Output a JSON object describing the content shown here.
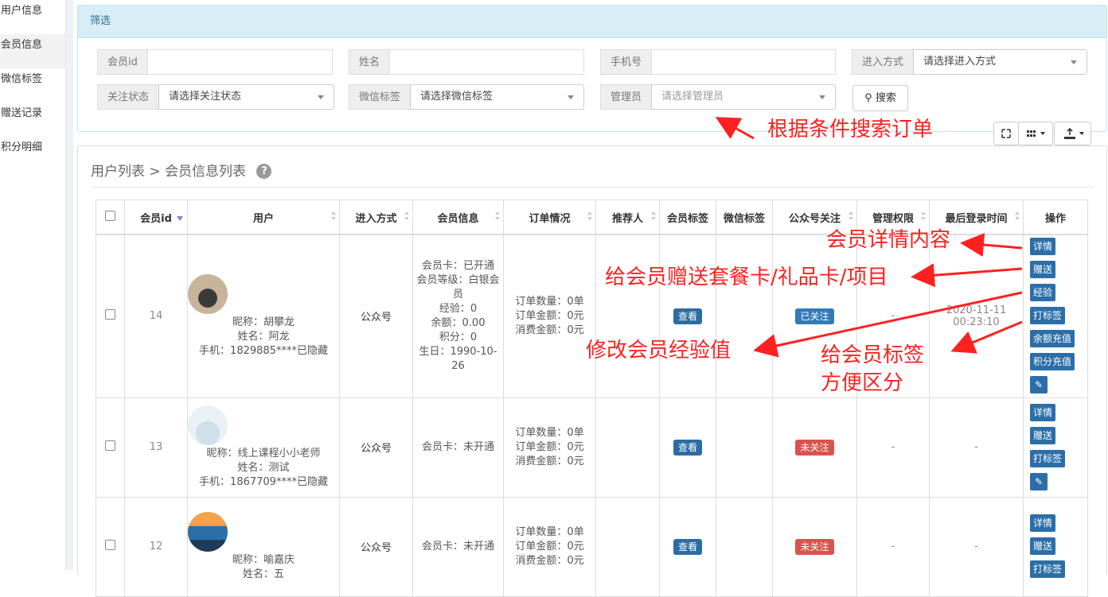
{
  "sidebar": {
    "items": [
      {
        "label": "用户信息",
        "active": false
      },
      {
        "label": "会员信息",
        "active": true
      },
      {
        "label": "微信标签",
        "active": false
      },
      {
        "label": "赠送记录",
        "active": false
      },
      {
        "label": "积分明细",
        "active": false
      }
    ]
  },
  "filter": {
    "title": "筛选",
    "member_id_label": "会员id",
    "member_id_value": "",
    "name_label": "姓名",
    "name_value": "",
    "phone_label": "手机号",
    "phone_value": "",
    "entry_label": "进入方式",
    "entry_placeholder": "请选择进入方式",
    "follow_label": "关注状态",
    "follow_placeholder": "请选择关注状态",
    "wechat_tag_label": "微信标签",
    "wechat_tag_placeholder": "请选择微信标签",
    "admin_label": "管理员",
    "admin_placeholder": "请选择管理员",
    "search_label": "搜索"
  },
  "annotations": {
    "search": "根据条件搜索订单",
    "detail": "会员详情内容",
    "gift": "给会员赠送套餐卡/礼品卡/项目",
    "exp": "修改会员经验值",
    "tag_line1": "给会员标签",
    "tag_line2": "方便区分"
  },
  "breadcrumb": {
    "parent": "用户列表",
    "sep": ">",
    "current": "会员信息列表",
    "help": "?"
  },
  "table": {
    "columns": [
      "会员id",
      "用户",
      "进入方式",
      "会员信息",
      "订单情况",
      "推荐人",
      "会员标签",
      "微信标签",
      "公众号关注",
      "管理权限",
      "最后登录时间",
      "操作"
    ],
    "rows": [
      {
        "id": "14",
        "nickname": "昵称：胡攀龙",
        "name": "姓名：阿龙",
        "phone": "手机：1829885****已隐藏",
        "entry": "公众号",
        "member_info": [
          "会员卡：已开通",
          "会员等级：白银会员",
          "经验：0",
          "余额：0.00",
          "积分：0",
          "生日：1990-10-26"
        ],
        "orders": [
          "订单数量：0单",
          "订单金额：0元",
          "消费金额：0元"
        ],
        "referrer": "",
        "member_tag": "查看",
        "wechat_tag": "",
        "follow": "已关注",
        "admin": "-",
        "last_login_date": "2020-11-11",
        "last_login_time": "00:23:10",
        "ops": [
          "详情",
          "赠送",
          "经验",
          "打标签",
          "余额充值",
          "积分充值"
        ]
      },
      {
        "id": "13",
        "nickname": "昵称：线上课程小小老师",
        "name": "姓名：测试",
        "phone": "手机：1867709****已隐藏",
        "entry": "公众号",
        "member_info": [
          "会员卡：未开通"
        ],
        "orders": [
          "订单数量：0单",
          "订单金额：0元",
          "消费金额：0元"
        ],
        "referrer": "",
        "member_tag": "查看",
        "wechat_tag": "",
        "follow": "未关注",
        "admin": "-",
        "last_login": "-",
        "ops": [
          "详情",
          "赠送",
          "打标签"
        ]
      },
      {
        "id": "12",
        "nickname": "昵称：喻嘉庆",
        "name": "姓名：五",
        "entry": "公众号",
        "member_info": [
          "会员卡：未开通"
        ],
        "orders": [
          "订单数量：0单",
          "订单金额：0元",
          "消费金额：0元"
        ],
        "referrer": "",
        "member_tag": "查看",
        "wechat_tag": "",
        "follow": "未关注",
        "admin": "-",
        "last_login": "-",
        "ops": [
          "详情",
          "赠送",
          "打标签"
        ]
      }
    ]
  },
  "colors": {
    "annotation": "#ff2020",
    "primary": "#2b6ea8",
    "danger": "#d9534f",
    "filter_header": "#d9edf7"
  }
}
